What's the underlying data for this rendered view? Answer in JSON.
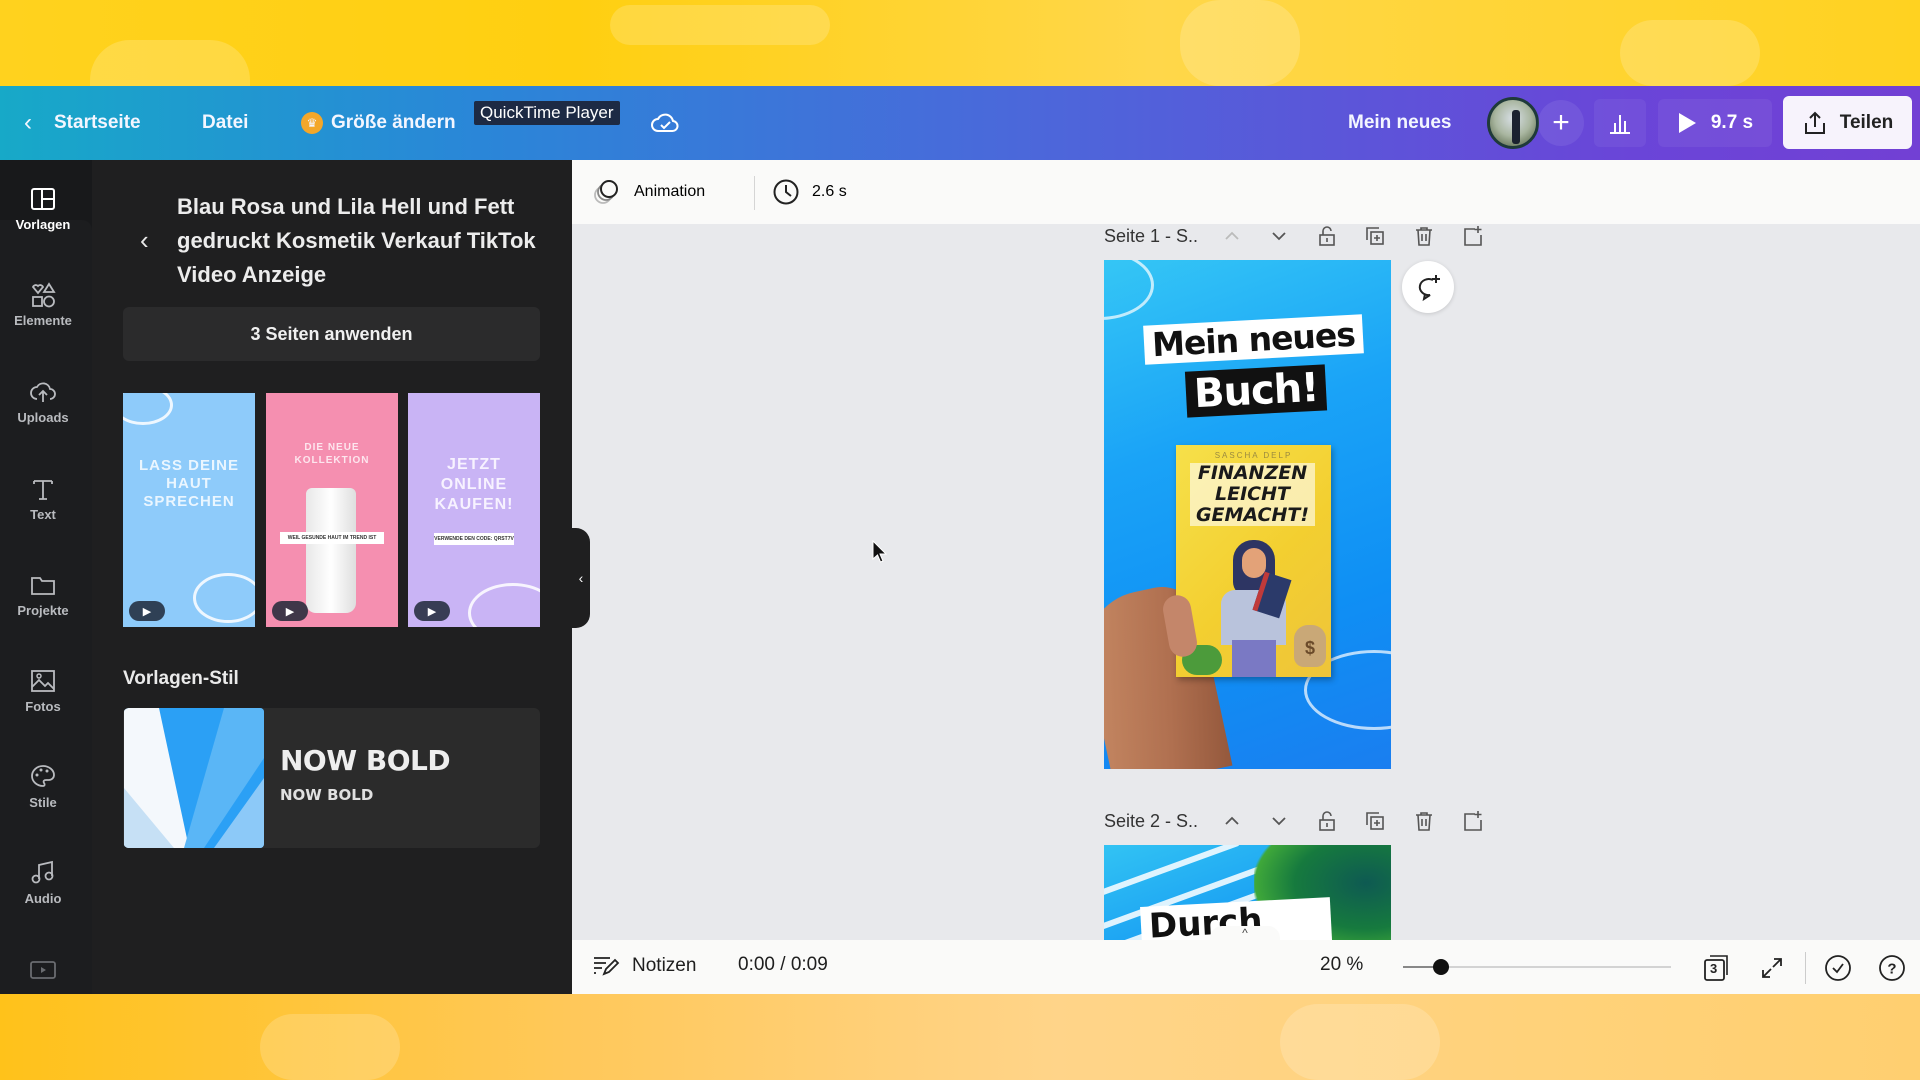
{
  "overlay": {
    "tooltip": "QuickTime Player"
  },
  "topbar": {
    "back_label": "Startseite",
    "file_label": "Datei",
    "resize_label": "Größe ändern",
    "design_title": "Mein neues",
    "play_duration": "9.7 s",
    "share_label": "Teilen",
    "accent_gradient": [
      "#17a9c8",
      "#4d66da",
      "#7240d4"
    ]
  },
  "rail": {
    "items": [
      {
        "label": "Vorlagen",
        "icon": "template-icon",
        "active": true
      },
      {
        "label": "Elemente",
        "icon": "shapes-icon"
      },
      {
        "label": "Uploads",
        "icon": "cloud-upload-icon"
      },
      {
        "label": "Text",
        "icon": "text-icon"
      },
      {
        "label": "Projekte",
        "icon": "folder-icon"
      },
      {
        "label": "Fotos",
        "icon": "image-icon"
      },
      {
        "label": "Stile",
        "icon": "palette-icon"
      },
      {
        "label": "Audio",
        "icon": "music-note-icon"
      }
    ]
  },
  "panel": {
    "title": "Blau Rosa und Lila Hell und Fett gedruckt Kosmetik Verkauf TikTok Video Anzeige",
    "apply_button": "3 Seiten anwenden",
    "thumbnails": [
      {
        "text": "LASS DEINE HAUT SPRECHEN",
        "color": "#8ecbfa"
      },
      {
        "text": "DIE NEUE KOLLEKTION",
        "caption": "WEIL GESUNDE HAUT IM TREND IST",
        "color": "#f58fb0"
      },
      {
        "text": "JETZT ONLINE KAUFEN!",
        "caption": "VERWENDE DEN CODE: QRST7V",
        "color": "#c9b4f5"
      }
    ],
    "style_section_title": "Vorlagen-Stil",
    "style": {
      "name": "NOW BOLD",
      "subname": "NOW BOLD"
    }
  },
  "editor_toolbar": {
    "animation_label": "Animation",
    "duration": "2.6 s"
  },
  "pages": [
    {
      "header": "Seite 1 - S..",
      "content": {
        "line1": "Mein neues",
        "line2": "Buch!",
        "book_author": "SASCHA DELP",
        "book_title": "FINANZEN LEICHT GEMACHT!",
        "money_symbol": "$"
      }
    },
    {
      "header": "Seite 2 - S..",
      "content": {
        "line1": "Durch den"
      }
    }
  ],
  "bottombar": {
    "notes_label": "Notizen",
    "time": "0:00 / 0:09",
    "zoom": "20 %",
    "zoom_fraction": 0.14,
    "page_count": "3"
  }
}
